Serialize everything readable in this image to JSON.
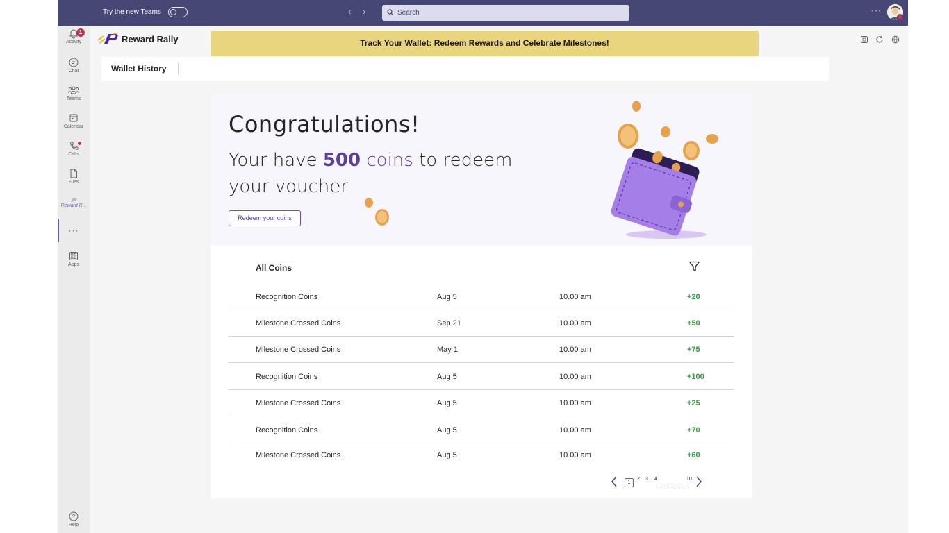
{
  "topbar": {
    "try_new_teams": "Try the new Teams",
    "search_placeholder": "Search",
    "more": "···"
  },
  "rail": {
    "items": [
      {
        "label": "Activity",
        "icon": "bell-icon",
        "badge": "1"
      },
      {
        "label": "Chat",
        "icon": "chat-icon"
      },
      {
        "label": "Teams",
        "icon": "teams-icon"
      },
      {
        "label": "Calendar",
        "icon": "calendar-icon"
      },
      {
        "label": "Calls",
        "icon": "phone-icon"
      },
      {
        "label": "Files",
        "icon": "file-icon"
      },
      {
        "label": "Reward R...",
        "icon": "reward-app-icon",
        "active": true
      },
      {
        "label": "···",
        "icon": "more-icon"
      },
      {
        "label": "Apps",
        "icon": "apps-icon"
      },
      {
        "label": "Help",
        "icon": "help-icon"
      }
    ]
  },
  "app": {
    "name": "Reward Rally",
    "banner": "Track Your Wallet: Redeem Rewards and Celebrate Milestones!",
    "tab": "Wallet History"
  },
  "hero": {
    "title": "Congratulations!",
    "line_prefix": "Your have ",
    "coins_amount": "500",
    "coins_unit": "coins",
    "line_suffix": " to redeem your voucher",
    "button": "Redeem your coins"
  },
  "table": {
    "title": "All Coins",
    "rows": [
      {
        "name": "Recognition Coins",
        "date": "Aug 5",
        "time": "10.00 am",
        "amount": "+20"
      },
      {
        "name": "Milestone Crossed Coins",
        "date": "Sep 21",
        "time": "10.00 am",
        "amount": "+50"
      },
      {
        "name": "Milestone Crossed Coins",
        "date": "May 1",
        "time": "10.00 am",
        "amount": "+75"
      },
      {
        "name": "Recognition Coins",
        "date": "Aug 5",
        "time": "10.00 am",
        "amount": "+100"
      },
      {
        "name": "Milestone Crossed Coins",
        "date": "Aug 5",
        "time": "10.00 am",
        "amount": "+25"
      },
      {
        "name": "Recognition Coins",
        "date": "Aug 5",
        "time": "10.00 am",
        "amount": "+70"
      },
      {
        "name": "Milestone Crossed Coins",
        "date": "Aug 5",
        "time": "10.00 am",
        "amount": "+60"
      }
    ]
  },
  "pagination": {
    "current": "1",
    "pages": [
      "2",
      "3",
      "4"
    ],
    "last": "10"
  },
  "colors": {
    "teams_purple": "#464775",
    "accent_purple": "#5b3f9b",
    "banner_yellow": "#ead57f",
    "positive_green": "#3a9b4b"
  }
}
